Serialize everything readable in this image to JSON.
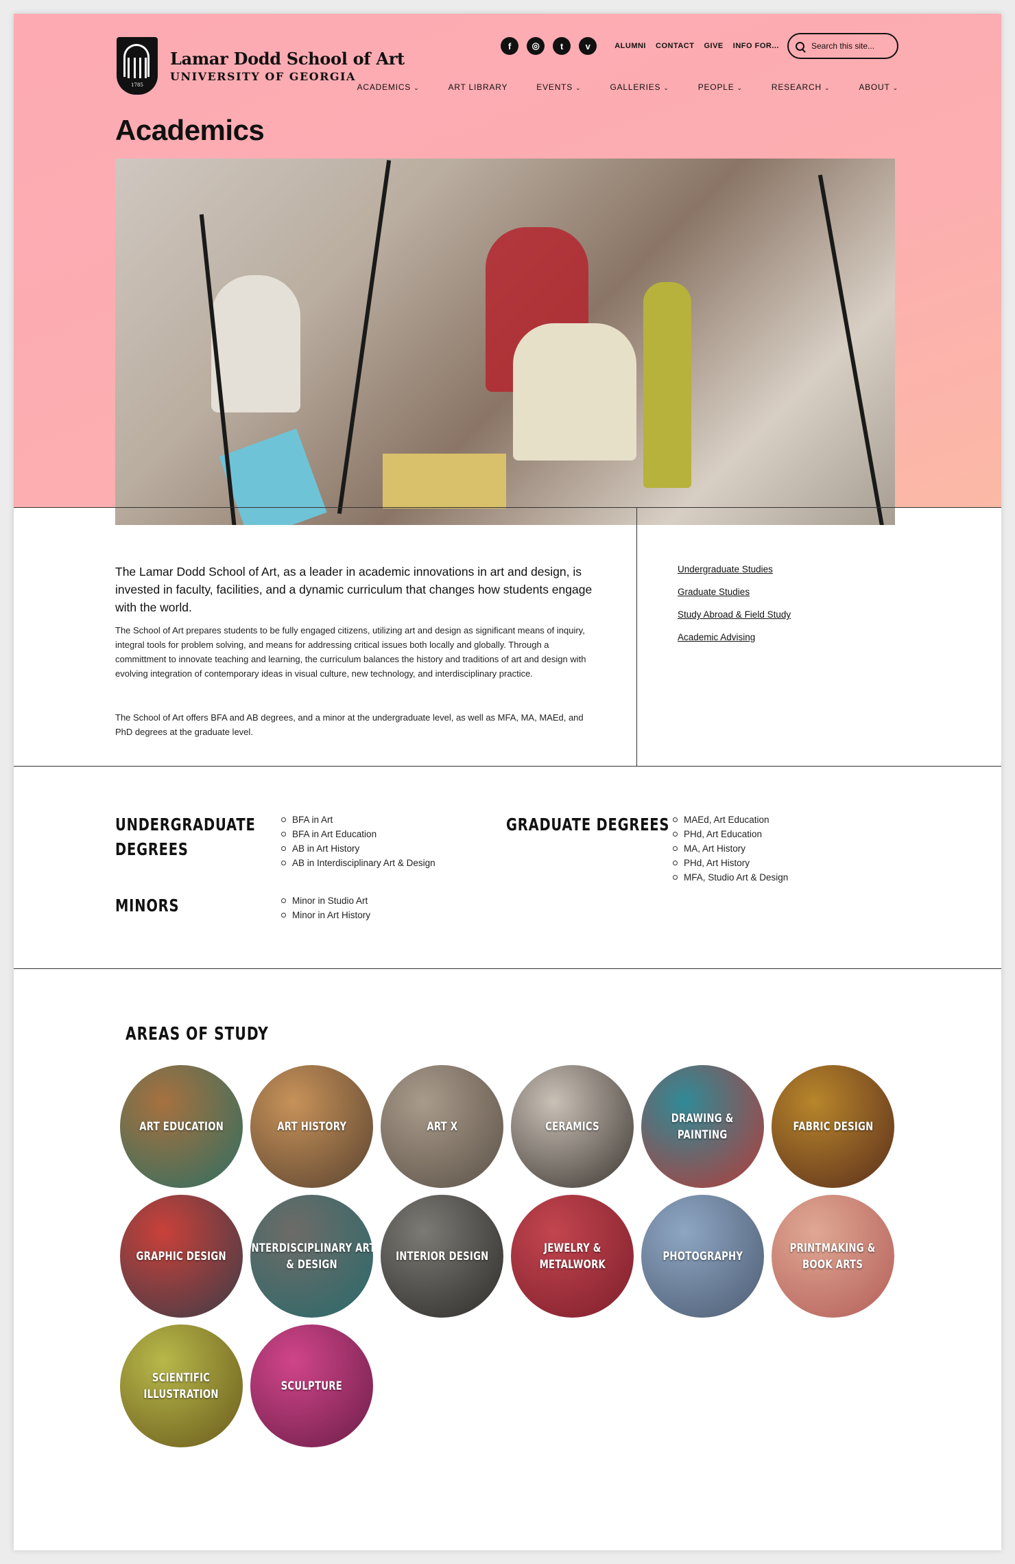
{
  "header": {
    "school_name": "Lamar Dodd School of Art",
    "university": "UNIVERSITY OF GEORGIA",
    "seal_year": "1785",
    "social": [
      {
        "name": "facebook-icon",
        "glyph": "f"
      },
      {
        "name": "instagram-icon",
        "glyph": "◎"
      },
      {
        "name": "twitter-icon",
        "glyph": "t"
      },
      {
        "name": "vimeo-icon",
        "glyph": "v"
      }
    ],
    "utility_links": [
      "ALUMNI",
      "CONTACT",
      "GIVE",
      "INFO FOR..."
    ],
    "search_placeholder": "Search this site..."
  },
  "nav": [
    {
      "label": "ACADEMICS",
      "dropdown": true
    },
    {
      "label": "ART LIBRARY",
      "dropdown": false
    },
    {
      "label": "EVENTS",
      "dropdown": true
    },
    {
      "label": "GALLERIES",
      "dropdown": true
    },
    {
      "label": "PEOPLE",
      "dropdown": true
    },
    {
      "label": "RESEARCH",
      "dropdown": true
    },
    {
      "label": "ABOUT",
      "dropdown": true
    }
  ],
  "page_title": "Academics",
  "intro": {
    "lead": "The Lamar Dodd School of Art, as a leader in academic innovations in art and design, is invested in faculty, facilities, and a dynamic curriculum that changes how students engage with the world.",
    "p1": "The School of Art prepares students to be fully engaged citizens, utilizing art and design as significant means of inquiry, integral tools for problem solving, and means for addressing critical issues both locally and globally. Through a committment to innovate teaching and learning, the curriculum balances the history and traditions of art and design with evolving integration of contemporary ideas in visual culture, new technology, and interdisciplinary practice.",
    "p2": "The School of Art offers BFA and AB degrees, and a minor at the undergraduate level, as well as MFA, MA, MAEd, and PhD degrees at the graduate level."
  },
  "side_links": [
    "Undergraduate Studies",
    "Graduate Studies",
    "Study Abroad & Field Study",
    "Academic Advising"
  ],
  "degrees": {
    "undergrad_heading": "UNDERGRADUATE DEGREES",
    "undergrad": [
      "BFA in Art",
      "BFA in Art Education",
      "AB in Art History",
      "AB in Interdisciplinary Art & Design"
    ],
    "minors_heading": "MINORS",
    "minors": [
      "Minor in Studio Art",
      "Minor in Art History"
    ],
    "grad_heading": "GRADUATE DEGREES",
    "grad": [
      "MAEd, Art Education",
      "PHd, Art Education",
      "MA, Art History",
      "PHd, Art History",
      "MFA, Studio Art & Design"
    ]
  },
  "areas": {
    "title": "AREAS OF STUDY",
    "items": [
      {
        "label": "ART EDUCATION",
        "c1": "#a7713f",
        "c2": "#2e6e62"
      },
      {
        "label": "ART HISTORY",
        "c1": "#c79259",
        "c2": "#5a4330"
      },
      {
        "label": "ART X",
        "c1": "#a99b8b",
        "c2": "#5b5147"
      },
      {
        "label": "CERAMICS",
        "c1": "#c9c0b6",
        "c2": "#3d3732"
      },
      {
        "label": "DRAWING & PAINTING",
        "c1": "#2f8a97",
        "c2": "#b63b38"
      },
      {
        "label": "FABRIC DESIGN",
        "c1": "#b8862b",
        "c2": "#5a2e1c"
      },
      {
        "label": "GRAPHIC DESIGN",
        "c1": "#c9413a",
        "c2": "#3c3c48"
      },
      {
        "label": "INTERDISCIPLINARY ART & DESIGN",
        "c1": "#6d6b68",
        "c2": "#2a6a6a"
      },
      {
        "label": "INTERIOR DESIGN",
        "c1": "#7c7a74",
        "c2": "#2d2c2a"
      },
      {
        "label": "JEWELRY & METALWORK",
        "c1": "#c2454f",
        "c2": "#7e1f2b"
      },
      {
        "label": "PHOTOGRAPHY",
        "c1": "#8ea6c3",
        "c2": "#4d5c72"
      },
      {
        "label": "PRINTMAKING & BOOK ARTS",
        "c1": "#e0a894",
        "c2": "#b35e58"
      },
      {
        "label": "SCIENTIFIC ILLUSTRATION",
        "c1": "#b7b84a",
        "c2": "#6a5a1c"
      },
      {
        "label": "SCULPTURE",
        "c1": "#d0458a",
        "c2": "#6c1e48"
      }
    ]
  }
}
